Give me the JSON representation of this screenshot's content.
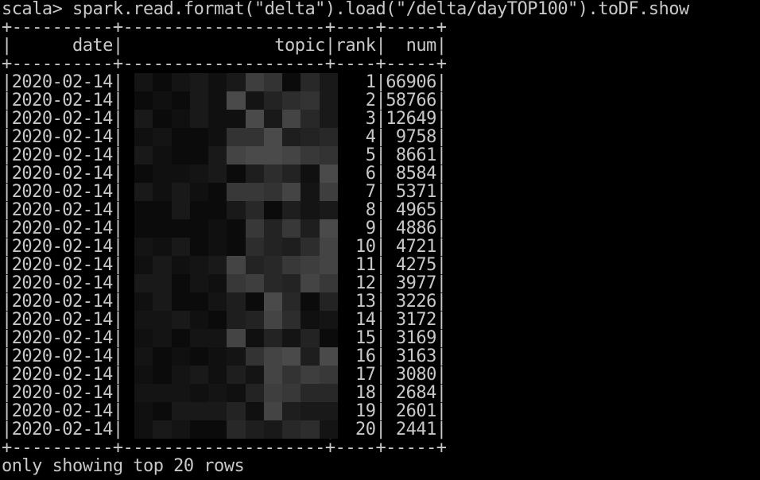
{
  "terminal": {
    "prompt": "scala>",
    "command": " spark.read.format(\"delta\").load(\"/delta/dayTOP100\").toDF.show",
    "border_line": "+----------+--------------------+----+-----+",
    "header_line": "|      date|               topic|rank|  num|",
    "rows": [
      {
        "date": "2020-02-14",
        "rank": "1",
        "num": "66906"
      },
      {
        "date": "2020-02-14",
        "rank": "2",
        "num": "58766"
      },
      {
        "date": "2020-02-14",
        "rank": "3",
        "num": "12649"
      },
      {
        "date": "2020-02-14",
        "rank": "4",
        "num": "9758"
      },
      {
        "date": "2020-02-14",
        "rank": "5",
        "num": "8661"
      },
      {
        "date": "2020-02-14",
        "rank": "6",
        "num": "8584"
      },
      {
        "date": "2020-02-14",
        "rank": "7",
        "num": "5371"
      },
      {
        "date": "2020-02-14",
        "rank": "8",
        "num": "4965"
      },
      {
        "date": "2020-02-14",
        "rank": "9",
        "num": "4886"
      },
      {
        "date": "2020-02-14",
        "rank": "10",
        "num": "4721"
      },
      {
        "date": "2020-02-14",
        "rank": "11",
        "num": "4275"
      },
      {
        "date": "2020-02-14",
        "rank": "12",
        "num": "3977"
      },
      {
        "date": "2020-02-14",
        "rank": "13",
        "num": "3226"
      },
      {
        "date": "2020-02-14",
        "rank": "14",
        "num": "3172"
      },
      {
        "date": "2020-02-14",
        "rank": "15",
        "num": "3169"
      },
      {
        "date": "2020-02-14",
        "rank": "16",
        "num": "3163"
      },
      {
        "date": "2020-02-14",
        "rank": "17",
        "num": "3080"
      },
      {
        "date": "2020-02-14",
        "rank": "18",
        "num": "2684"
      },
      {
        "date": "2020-02-14",
        "rank": "19",
        "num": "2601"
      },
      {
        "date": "2020-02-14",
        "rank": "20",
        "num": "2441"
      }
    ],
    "footer": "only showing top 20 rows",
    "colors": {
      "background": "#000000",
      "text": "#c8c8c8",
      "pixelation_dark": "#0c0c0c",
      "pixelation_light": "#4a4a4a"
    },
    "topic_column_state": "pixelated (redacted)"
  }
}
